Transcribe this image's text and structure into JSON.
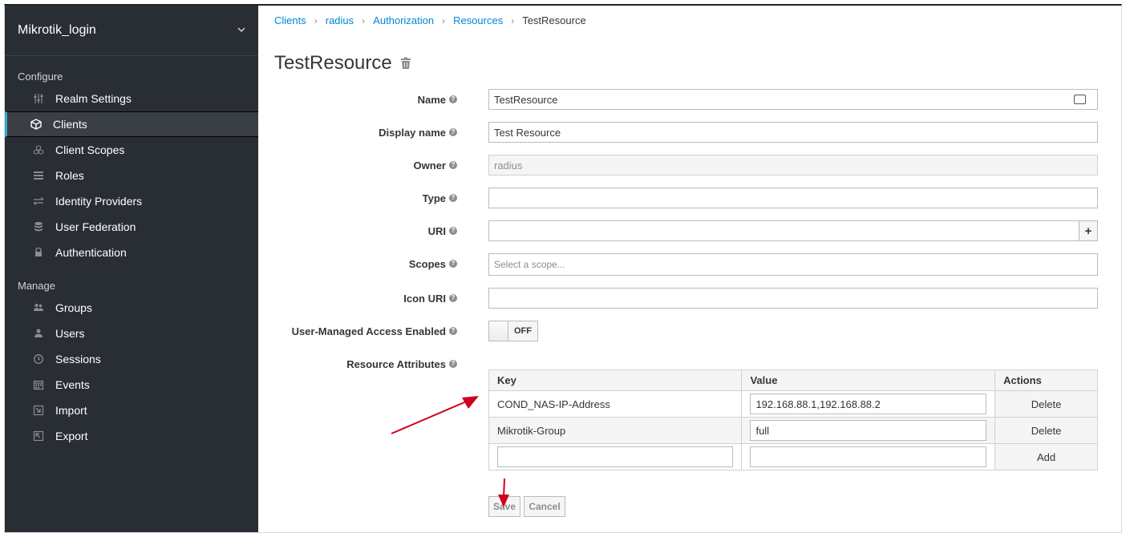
{
  "sidebar": {
    "realm": "Mikrotik_login",
    "sections": {
      "configure": "Configure",
      "manage": "Manage"
    },
    "configure_items": [
      {
        "label": "Realm Settings",
        "icon": "sliders-icon",
        "active": false
      },
      {
        "label": "Clients",
        "icon": "cube-icon",
        "active": true
      },
      {
        "label": "Client Scopes",
        "icon": "cubes-icon",
        "active": false
      },
      {
        "label": "Roles",
        "icon": "list-icon",
        "active": false
      },
      {
        "label": "Identity Providers",
        "icon": "exchange-icon",
        "active": false
      },
      {
        "label": "User Federation",
        "icon": "database-icon",
        "active": false
      },
      {
        "label": "Authentication",
        "icon": "lock-icon",
        "active": false
      }
    ],
    "manage_items": [
      {
        "label": "Groups",
        "icon": "users-icon"
      },
      {
        "label": "Users",
        "icon": "user-icon"
      },
      {
        "label": "Sessions",
        "icon": "clock-icon"
      },
      {
        "label": "Events",
        "icon": "calendar-icon"
      },
      {
        "label": "Import",
        "icon": "import-icon"
      },
      {
        "label": "Export",
        "icon": "export-icon"
      }
    ]
  },
  "breadcrumb": {
    "items": [
      "Clients",
      "radius",
      "Authorization",
      "Resources"
    ],
    "current": "TestResource"
  },
  "page": {
    "title": "TestResource"
  },
  "form": {
    "name": {
      "label": "Name",
      "value": "TestResource"
    },
    "display_name": {
      "label": "Display name",
      "value": "Test Resource"
    },
    "owner": {
      "label": "Owner",
      "value": "radius"
    },
    "type": {
      "label": "Type",
      "value": ""
    },
    "uri": {
      "label": "URI",
      "value": "",
      "add": "+"
    },
    "scopes": {
      "label": "Scopes",
      "placeholder": "Select a scope..."
    },
    "icon_uri": {
      "label": "Icon URI",
      "value": ""
    },
    "uma": {
      "label": "User-Managed Access Enabled",
      "state": "OFF"
    },
    "attributes": {
      "label": "Resource Attributes"
    }
  },
  "attributes_table": {
    "headers": {
      "key": "Key",
      "value": "Value",
      "actions": "Actions"
    },
    "rows": [
      {
        "key": "COND_NAS-IP-Address",
        "value": "192.168.88.1,192.168.88.2",
        "action": "Delete"
      },
      {
        "key": "Mikrotik-Group",
        "value": "full",
        "action": "Delete"
      }
    ],
    "new_row": {
      "key": "",
      "value": "",
      "action": "Add"
    }
  },
  "buttons": {
    "save": "Save",
    "cancel": "Cancel"
  },
  "colors": {
    "sidebar_bg": "#292e34",
    "accent": "#39a5dc",
    "link": "#0088ce",
    "annotation_arrow": "#d0021b"
  }
}
